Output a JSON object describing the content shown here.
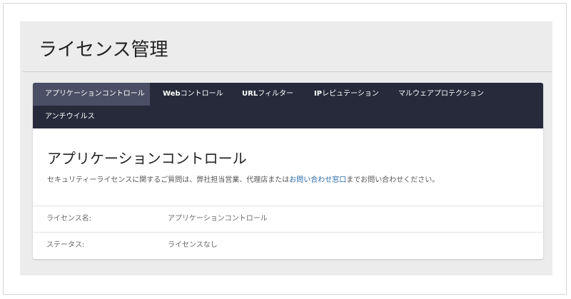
{
  "page": {
    "title": "ライセンス管理"
  },
  "tabs": [
    {
      "pre": "アプリケーションコントロール",
      "bold": "",
      "post": ""
    },
    {
      "pre": "",
      "bold": "Web",
      "post": "コントロール"
    },
    {
      "pre": "",
      "bold": "URL",
      "post": "フィルター"
    },
    {
      "pre": "",
      "bold": "IP",
      "post": "レピュテーション"
    },
    {
      "pre": "マルウェアプロテクション",
      "bold": "",
      "post": ""
    },
    {
      "pre": "アンチウイルス",
      "bold": "",
      "post": ""
    }
  ],
  "section": {
    "title": "アプリケーションコントロール",
    "desc_before": "セキュリティーライセンスに関するご質問は、弊社担当営業、代理店または",
    "desc_link": "お問い合わせ窓口",
    "desc_after": "までお問い合わせください。"
  },
  "rows": [
    {
      "label": "ライセンス名:",
      "value": "アプリケーションコントロール"
    },
    {
      "label": "ステータス:",
      "value": "ライセンスなし"
    }
  ],
  "colors": {
    "tabbar": "#262a3b",
    "active_tab": "#4a4f66",
    "link": "#2a6aa6"
  }
}
